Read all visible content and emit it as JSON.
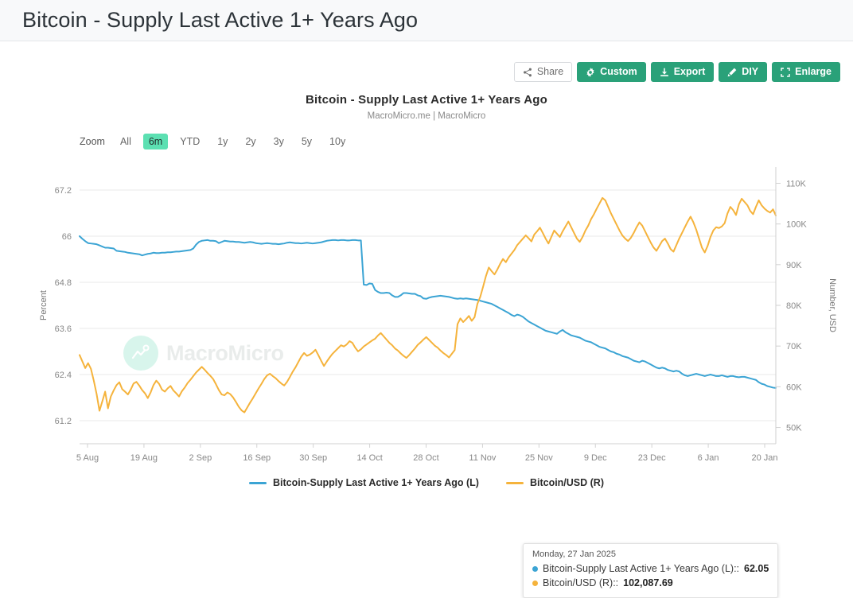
{
  "page_header": {
    "title": "Bitcoin - Supply Last Active 1+ Years Ago"
  },
  "toolbar": {
    "buttons": [
      {
        "label": "Share",
        "icon": "share-icon",
        "style": "light"
      },
      {
        "label": "Custom",
        "icon": "gear-icon",
        "style": "green"
      },
      {
        "label": "Export",
        "icon": "download-icon",
        "style": "green"
      },
      {
        "label": "DIY",
        "icon": "pencil-icon",
        "style": "green"
      },
      {
        "label": "Enlarge",
        "icon": "expand-icon",
        "style": "green"
      }
    ]
  },
  "chart_heading": {
    "title": "Bitcoin - Supply Last Active 1+ Years Ago",
    "subtitle": "MacroMicro.me | MacroMicro"
  },
  "range_selector": {
    "label": "Zoom",
    "options": [
      "All",
      "6m",
      "YTD",
      "1y",
      "2y",
      "3y",
      "5y",
      "10y"
    ],
    "selected": "6m"
  },
  "watermark": {
    "text": "MacroMicro",
    "logo_icon": "macromicro-logo-icon"
  },
  "tooltip": {
    "date": "Monday, 27 Jan 2025",
    "rows": [
      {
        "series": "Bitcoin-Supply Last Active 1+ Years Ago (L)",
        "value": "62.05",
        "color": "#3BA4D4"
      },
      {
        "series": "Bitcoin/USD (R)",
        "value": "102,087.69",
        "color": "#F5B33C"
      }
    ]
  },
  "legend": {
    "items": [
      {
        "label": "Bitcoin-Supply Last Active 1+ Years Ago (L)",
        "color": "#3BA4D4"
      },
      {
        "label": "Bitcoin/USD (R)",
        "color": "#F5B33C"
      }
    ]
  },
  "colors": {
    "blue": "#3BA4D4",
    "orange": "#F5B33C",
    "green": "#2aa179",
    "highlight": "#5ce0b2",
    "grid": "#e8e8e8",
    "axis": "#d2d2d2"
  },
  "chart_data": {
    "type": "line",
    "title": "Bitcoin - Supply Last Active 1+ Years Ago",
    "subtitle": "MacroMicro.me | MacroMicro",
    "xlabel": "",
    "grid": true,
    "legend_position": "bottom",
    "x_tick_labels": [
      "5 Aug",
      "19 Aug",
      "2 Sep",
      "16 Sep",
      "30 Sep",
      "14 Oct",
      "28 Oct",
      "11 Nov",
      "25 Nov",
      "9 Dec",
      "23 Dec",
      "6 Jan",
      "20 Jan"
    ],
    "x_range": [
      "2024-07-29",
      "2025-01-27"
    ],
    "axes": [
      {
        "side": "left",
        "label": "Percent",
        "ticks": [
          61.2,
          62.4,
          63.6,
          64.8,
          66,
          67.2
        ],
        "tick_labels": [
          "61.2",
          "62.4",
          "63.6",
          "64.8",
          "66",
          "67.2"
        ],
        "ylim": [
          60.6,
          67.8
        ]
      },
      {
        "side": "right",
        "label": "Number, USD",
        "ticks": [
          50000,
          60000,
          70000,
          80000,
          90000,
          100000,
          110000
        ],
        "tick_labels": [
          "50K",
          "60K",
          "70K",
          "80K",
          "90K",
          "100K",
          "110K"
        ],
        "ylim": [
          46000,
          114000
        ]
      }
    ],
    "series": [
      {
        "name": "Bitcoin-Supply Last Active 1+ Years Ago (L)",
        "axis": "left",
        "unit": "Percent",
        "color": "#3BA4D4",
        "values": [
          66.0,
          65.93,
          65.87,
          65.82,
          65.81,
          65.8,
          65.79,
          65.76,
          65.73,
          65.7,
          65.7,
          65.69,
          65.68,
          65.62,
          65.61,
          65.6,
          65.59,
          65.57,
          65.56,
          65.55,
          65.54,
          65.53,
          65.5,
          65.52,
          65.54,
          65.55,
          65.57,
          65.56,
          65.56,
          65.57,
          65.57,
          65.58,
          65.58,
          65.59,
          65.6,
          65.6,
          65.61,
          65.62,
          65.63,
          65.64,
          65.68,
          65.78,
          65.85,
          65.88,
          65.89,
          65.9,
          65.88,
          65.88,
          65.87,
          65.82,
          65.85,
          65.88,
          65.87,
          65.86,
          65.86,
          65.85,
          65.85,
          65.84,
          65.83,
          65.84,
          65.85,
          65.84,
          65.82,
          65.81,
          65.8,
          65.81,
          65.82,
          65.81,
          65.8,
          65.8,
          65.79,
          65.8,
          65.81,
          65.83,
          65.84,
          65.83,
          65.82,
          65.82,
          65.81,
          65.82,
          65.83,
          65.82,
          65.81,
          65.82,
          65.83,
          65.84,
          65.86,
          65.88,
          65.89,
          65.9,
          65.9,
          65.89,
          65.9,
          65.9,
          65.89,
          65.89,
          65.9,
          65.9,
          65.89,
          65.89,
          64.74,
          64.73,
          64.77,
          64.76,
          64.6,
          64.55,
          64.52,
          64.52,
          64.53,
          64.52,
          64.46,
          64.42,
          64.42,
          64.46,
          64.52,
          64.52,
          64.51,
          64.5,
          64.5,
          64.46,
          64.44,
          64.38,
          64.37,
          64.4,
          64.42,
          64.43,
          64.44,
          64.45,
          64.44,
          64.43,
          64.42,
          64.4,
          64.38,
          64.37,
          64.38,
          64.37,
          64.38,
          64.37,
          64.36,
          64.35,
          64.34,
          64.32,
          64.3,
          64.28,
          64.26,
          64.24,
          64.2,
          64.16,
          64.12,
          64.08,
          64.04,
          64.0,
          63.95,
          63.92,
          63.96,
          63.94,
          63.9,
          63.84,
          63.78,
          63.74,
          63.7,
          63.66,
          63.62,
          63.58,
          63.54,
          63.52,
          63.5,
          63.48,
          63.46,
          63.52,
          63.56,
          63.5,
          63.46,
          63.42,
          63.4,
          63.38,
          63.36,
          63.32,
          63.28,
          63.26,
          63.24,
          63.2,
          63.16,
          63.12,
          63.1,
          63.08,
          63.04,
          63.0,
          62.98,
          62.94,
          62.92,
          62.88,
          62.86,
          62.84,
          62.8,
          62.76,
          62.74,
          62.72,
          62.76,
          62.74,
          62.7,
          62.66,
          62.62,
          62.58,
          62.56,
          62.58,
          62.56,
          62.52,
          62.5,
          62.48,
          62.5,
          62.48,
          62.42,
          62.38,
          62.36,
          62.38,
          62.4,
          62.42,
          62.4,
          62.38,
          62.36,
          62.38,
          62.4,
          62.38,
          62.36,
          62.36,
          62.38,
          62.36,
          62.34,
          62.36,
          62.36,
          62.34,
          62.33,
          62.34,
          62.34,
          62.32,
          62.3,
          62.28,
          62.26,
          62.2,
          62.16,
          62.14,
          62.1,
          62.08,
          62.06,
          62.05
        ]
      },
      {
        "name": "Bitcoin/USD (R)",
        "axis": "right",
        "unit": "USD",
        "color": "#F5B33C",
        "values": [
          67800,
          66200,
          64600,
          65800,
          64400,
          61500,
          58200,
          54100,
          56400,
          58800,
          54700,
          57600,
          59100,
          60400,
          61100,
          59400,
          58800,
          58100,
          59300,
          60800,
          61200,
          60300,
          59200,
          58400,
          57200,
          58600,
          60400,
          61500,
          60700,
          59300,
          58800,
          59600,
          60200,
          59100,
          58400,
          57600,
          58900,
          59800,
          60900,
          61700,
          62600,
          63500,
          64200,
          64900,
          64200,
          63400,
          62700,
          61900,
          60600,
          59200,
          58100,
          57900,
          58600,
          58200,
          57400,
          56300,
          55100,
          54200,
          53700,
          54900,
          56100,
          57200,
          58400,
          59600,
          60700,
          61900,
          62800,
          63200,
          62600,
          62100,
          61400,
          60800,
          60300,
          61200,
          62400,
          63700,
          64800,
          66100,
          67400,
          68300,
          67600,
          67900,
          68400,
          69100,
          67800,
          66400,
          65100,
          66200,
          67200,
          68100,
          68800,
          69500,
          70200,
          69900,
          70400,
          71200,
          70800,
          69600,
          68700,
          69200,
          69900,
          70400,
          70900,
          71400,
          71800,
          72600,
          73200,
          72400,
          71600,
          70800,
          70200,
          69400,
          68900,
          68200,
          67600,
          67100,
          67800,
          68600,
          69400,
          70300,
          70900,
          71600,
          72200,
          71500,
          70800,
          70100,
          69600,
          68900,
          68300,
          67800,
          67200,
          68100,
          69000,
          75400,
          76800,
          75900,
          76600,
          77400,
          76200,
          77100,
          80400,
          82100,
          84600,
          87200,
          89300,
          88400,
          87600,
          88800,
          90200,
          91400,
          90600,
          91800,
          92700,
          93600,
          94800,
          95600,
          96400,
          97200,
          96500,
          95700,
          97400,
          98200,
          99100,
          97800,
          96400,
          95200,
          96800,
          98400,
          97600,
          96800,
          98200,
          99400,
          100600,
          99200,
          97800,
          96400,
          95600,
          96800,
          98400,
          99600,
          101200,
          102400,
          103800,
          105100,
          106400,
          105800,
          104200,
          102600,
          101200,
          99800,
          98400,
          97200,
          96400,
          95800,
          96600,
          97800,
          99200,
          100400,
          99600,
          98200,
          96800,
          95400,
          94200,
          93400,
          94600,
          95800,
          96400,
          95200,
          93800,
          93200,
          94800,
          96400,
          97800,
          99200,
          100600,
          101800,
          100400,
          98600,
          96400,
          94200,
          93000,
          94600,
          96800,
          98400,
          99200,
          99000,
          99400,
          100200,
          102600,
          104200,
          103400,
          102200,
          104800,
          106200,
          105400,
          104600,
          103200,
          102400,
          104200,
          105800,
          104600,
          103800,
          103200,
          102800,
          103600,
          102088
        ]
      }
    ]
  }
}
